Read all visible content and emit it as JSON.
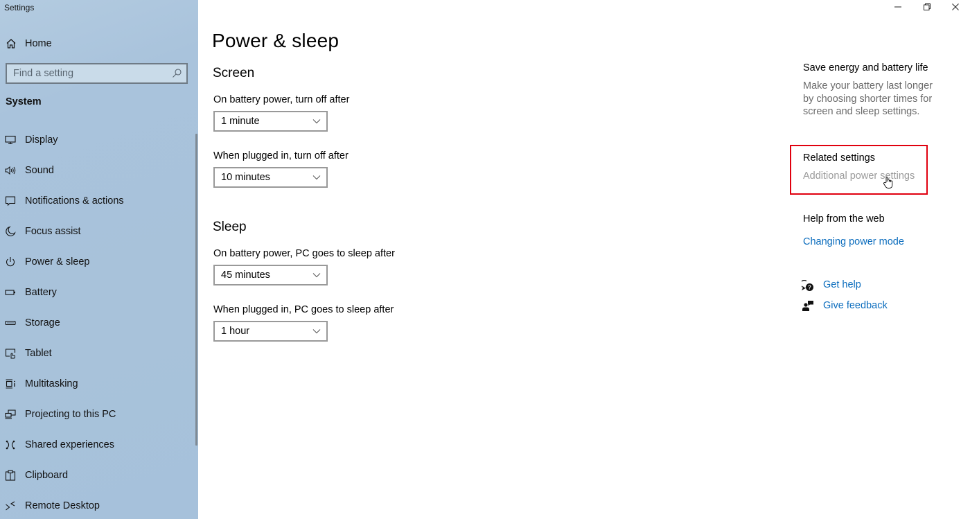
{
  "window": {
    "title": "Settings",
    "controls": {
      "minimize": "minimize-icon",
      "restore": "restore-icon",
      "close": "close-icon"
    }
  },
  "sidebar": {
    "home": {
      "label": "Home",
      "icon": "home-icon"
    },
    "search": {
      "placeholder": "Find a setting",
      "value": "",
      "icon": "search-icon"
    },
    "section": "System",
    "items": [
      {
        "label": "Display",
        "icon": "monitor-icon"
      },
      {
        "label": "Sound",
        "icon": "speaker-icon"
      },
      {
        "label": "Notifications & actions",
        "icon": "notification-icon"
      },
      {
        "label": "Focus assist",
        "icon": "moon-icon"
      },
      {
        "label": "Power & sleep",
        "icon": "power-icon",
        "selected": true
      },
      {
        "label": "Battery",
        "icon": "battery-icon"
      },
      {
        "label": "Storage",
        "icon": "storage-icon"
      },
      {
        "label": "Tablet",
        "icon": "tablet-icon"
      },
      {
        "label": "Multitasking",
        "icon": "multitasking-icon"
      },
      {
        "label": "Projecting to this PC",
        "icon": "projecting-icon"
      },
      {
        "label": "Shared experiences",
        "icon": "shared-experiences-icon"
      },
      {
        "label": "Clipboard",
        "icon": "clipboard-icon"
      },
      {
        "label": "Remote Desktop",
        "icon": "remote-desktop-icon"
      }
    ]
  },
  "main": {
    "title": "Power & sleep",
    "screen": {
      "heading": "Screen",
      "battery_label": "On battery power, turn off after",
      "battery_value": "1 minute",
      "plugged_label": "When plugged in, turn off after",
      "plugged_value": "10 minutes"
    },
    "sleep": {
      "heading": "Sleep",
      "battery_label": "On battery power, PC goes to sleep after",
      "battery_value": "45 minutes",
      "plugged_label": "When plugged in, PC goes to sleep after",
      "plugged_value": "1 hour"
    }
  },
  "aside": {
    "save_energy": {
      "heading": "Save energy and battery life",
      "description": "Make your battery last longer by choosing shorter times for screen and sleep settings."
    },
    "related": {
      "heading": "Related settings",
      "link": "Additional power settings"
    },
    "help_web": {
      "heading": "Help from the web",
      "link": "Changing power mode"
    },
    "get_help": {
      "label": "Get help",
      "icon": "get-help-icon"
    },
    "give_feedback": {
      "label": "Give feedback",
      "icon": "feedback-icon"
    }
  },
  "colors": {
    "link": "#0a6cbd",
    "highlight_border": "#e0000f",
    "sidebar_bg": "#a8c2da"
  }
}
